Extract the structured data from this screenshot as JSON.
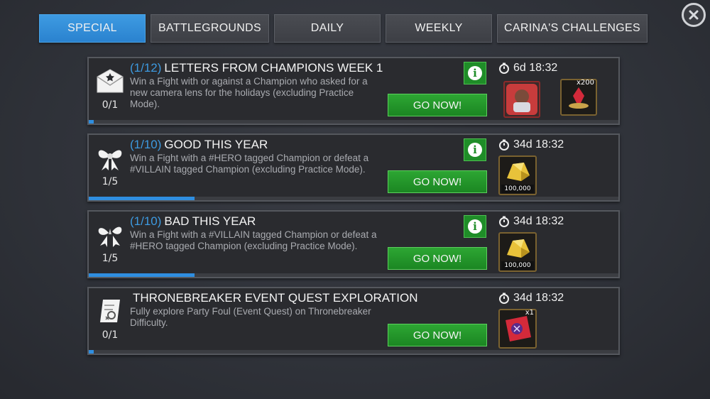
{
  "tabs": [
    {
      "label": "SPECIAL",
      "active": true
    },
    {
      "label": "BATTLEGROUNDS",
      "active": false
    },
    {
      "label": "DAILY",
      "active": false
    },
    {
      "label": "WEEKLY",
      "active": false
    },
    {
      "label": "CARINA'S CHALLENGES",
      "active": false
    }
  ],
  "close_icon": "close-icon",
  "quests": [
    {
      "fraction": "(1/12)",
      "title": "LETTERS FROM CHAMPIONS WEEK 1",
      "description": "Win a Fight with or against a Champion who asked for a new camera lens for the holidays (excluding Practice Mode).",
      "count": "0/1",
      "progress": 0.01,
      "timer": "6d 18:32",
      "has_info": true,
      "go_label": "GO NOW!",
      "icon": "envelope-icon",
      "rewards": [
        {
          "icon": "champion-portrait-icon",
          "qty": "",
          "amount": ""
        },
        {
          "icon": "crystal-icon",
          "qty": "x200",
          "amount": ""
        }
      ]
    },
    {
      "fraction": "(1/10)",
      "title": "GOOD THIS YEAR",
      "description": "Win a Fight with a #HERO tagged Champion or defeat a #VILLAIN tagged Champion (excluding Practice Mode).",
      "count": "1/5",
      "progress": 0.2,
      "timer": "34d 18:32",
      "has_info": true,
      "go_label": "GO NOW!",
      "icon": "bow-icon",
      "rewards": [
        {
          "icon": "gold-icon",
          "qty": "",
          "amount": "100,000"
        }
      ]
    },
    {
      "fraction": "(1/10)",
      "title": "BAD THIS YEAR",
      "description": "Win a Fight with a #VILLAIN tagged Champion or defeat a #HERO tagged Champion (excluding Practice Mode).",
      "count": "1/5",
      "progress": 0.2,
      "timer": "34d 18:32",
      "has_info": true,
      "go_label": "GO NOW!",
      "icon": "broken-bow-icon",
      "rewards": [
        {
          "icon": "gold-icon",
          "qty": "",
          "amount": "100,000"
        }
      ]
    },
    {
      "fraction": "",
      "title": "THRONEBREAKER EVENT QUEST EXPLORATION",
      "description": "Fully explore Party Foul (Event Quest) on Thronebreaker Difficulty.",
      "count": "0/1",
      "progress": 0.01,
      "timer": "34d 18:32",
      "has_info": false,
      "go_label": "GO NOW!",
      "icon": "map-scroll-icon",
      "rewards": [
        {
          "icon": "crystal-ticket-icon",
          "qty": "x1",
          "amount": ""
        }
      ]
    }
  ],
  "colors": {
    "accent_blue": "#2f8ee0",
    "go_green": "#1b8622",
    "gold_border": "#7a6230"
  }
}
